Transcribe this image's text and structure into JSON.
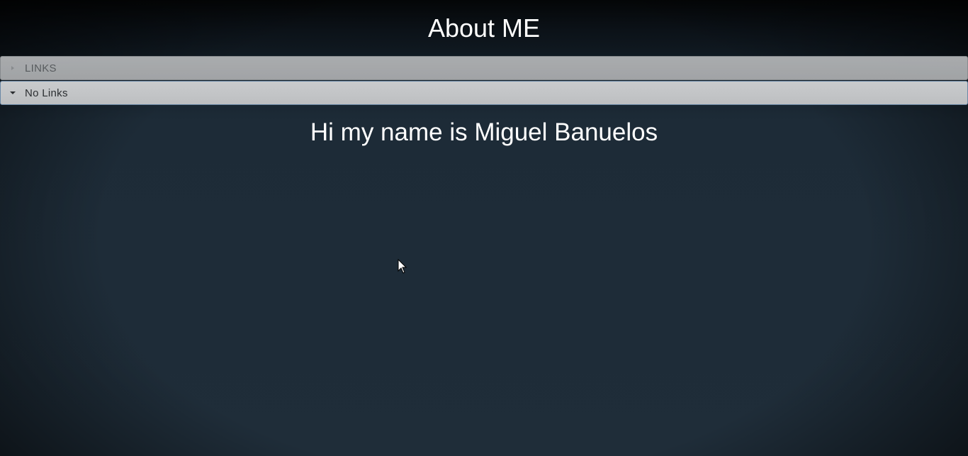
{
  "page": {
    "title": "About ME"
  },
  "accordion": {
    "sections": [
      {
        "label": "LINKS",
        "state": "collapsed",
        "icon": "triangle-right-icon"
      },
      {
        "label": "No Links",
        "state": "expanded",
        "icon": "triangle-down-icon"
      }
    ]
  },
  "content": {
    "heading": "Hi my name is Miguel Banuelos"
  },
  "colors": {
    "background": "#1f2d39",
    "text": "#ffffff",
    "header_bar": "#bdbfc1"
  }
}
